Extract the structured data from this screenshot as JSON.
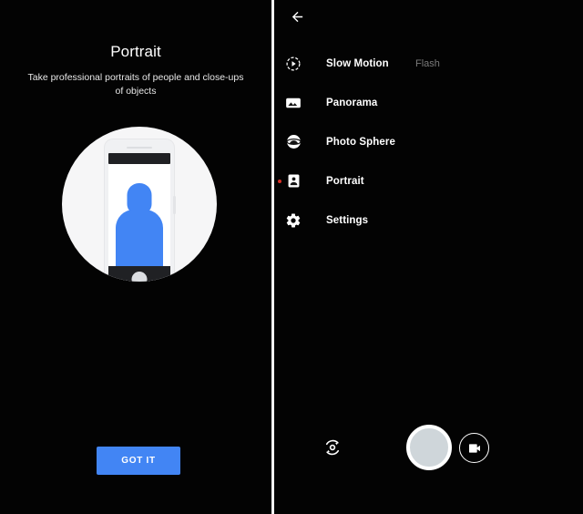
{
  "left_panel": {
    "title": "Portrait",
    "description": "Take professional portraits of people and close-ups of objects",
    "illustration_name": "portrait-mode-phone-illustration",
    "accent_color": "#4285f4",
    "cta": {
      "label": "GOT IT"
    }
  },
  "right_panel": {
    "back_icon": "back-arrow-icon",
    "flash_label": "Flash",
    "menu_items": [
      {
        "label": "Slow Motion",
        "icon": "slow-motion-icon",
        "selected": false
      },
      {
        "label": "Panorama",
        "icon": "panorama-icon",
        "selected": false
      },
      {
        "label": "Photo Sphere",
        "icon": "photo-sphere-icon",
        "selected": false
      },
      {
        "label": "Portrait",
        "icon": "portrait-icon",
        "selected": true
      },
      {
        "label": "Settings",
        "icon": "gear-icon",
        "selected": false
      }
    ],
    "selected_indicator_color": "#d93025",
    "controls": {
      "flip_camera_icon": "flip-camera-icon",
      "shutter_icon": "shutter-button",
      "video_icon": "video-camera-icon"
    }
  }
}
